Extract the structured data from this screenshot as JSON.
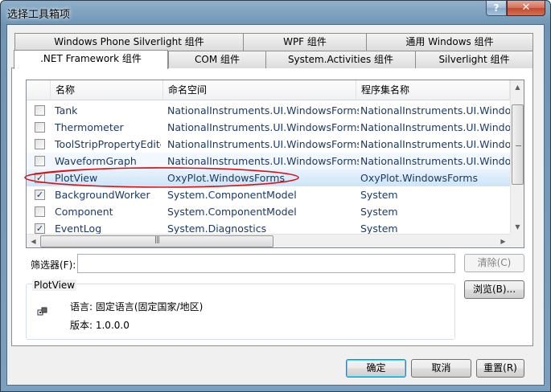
{
  "window": {
    "title": "选择工具箱项",
    "help_glyph": "?",
    "close_glyph": "✕"
  },
  "tabs": {
    "back_row": [
      "Windows Phone Silverlight 组件",
      "WPF 组件",
      "通用 Windows 组件"
    ],
    "front_row": [
      ".NET Framework 组件",
      "COM 组件",
      "System.Activities 组件",
      "Silverlight 组件"
    ],
    "active": ".NET Framework 组件"
  },
  "list": {
    "columns": [
      "名称",
      "命名空间",
      "程序集名称"
    ],
    "rows": [
      {
        "checked": false,
        "name": "Tank",
        "namespace": "NationalInstruments.UI.WindowsForms",
        "assembly": "NationalInstruments.UI.Windows"
      },
      {
        "checked": false,
        "name": "Thermometer",
        "namespace": "NationalInstruments.UI.WindowsForms",
        "assembly": "NationalInstruments.UI.Windows"
      },
      {
        "checked": false,
        "name": "ToolStripPropertyEdito",
        "namespace": "NationalInstruments.UI.WindowsForms",
        "assembly": "NationalInstruments.UI.Windows"
      },
      {
        "checked": false,
        "name": "WaveformGraph",
        "namespace": "NationalInstruments.UI.WindowsForms",
        "assembly": "NationalInstruments.UI.Windows"
      },
      {
        "checked": true,
        "name": "PlotView",
        "namespace": "OxyPlot.WindowsForms",
        "assembly": "OxyPlot.WindowsForms",
        "selected": true
      },
      {
        "checked": true,
        "name": "BackgroundWorker",
        "namespace": "System.ComponentModel",
        "assembly": "System"
      },
      {
        "checked": false,
        "name": "Component",
        "namespace": "System.ComponentModel",
        "assembly": "System"
      },
      {
        "checked": true,
        "name": "EventLog",
        "namespace": "System.Diagnostics",
        "assembly": "System"
      }
    ]
  },
  "filter": {
    "label": "筛选器(F):",
    "value": "",
    "clear_button": "清除(C)"
  },
  "info": {
    "group_title": "PlotView",
    "language": "语言: 固定语言(固定国家/地区)",
    "version": "版本: 1.0.0.0",
    "browse_button": "浏览(B)..."
  },
  "footer": {
    "ok_button": "确定",
    "cancel_button": "取消",
    "reset_button": "重置(R)"
  },
  "colors": {
    "annotation": "#d9121a",
    "selection": "#cde5f8",
    "link_text": "#1b3a66"
  }
}
